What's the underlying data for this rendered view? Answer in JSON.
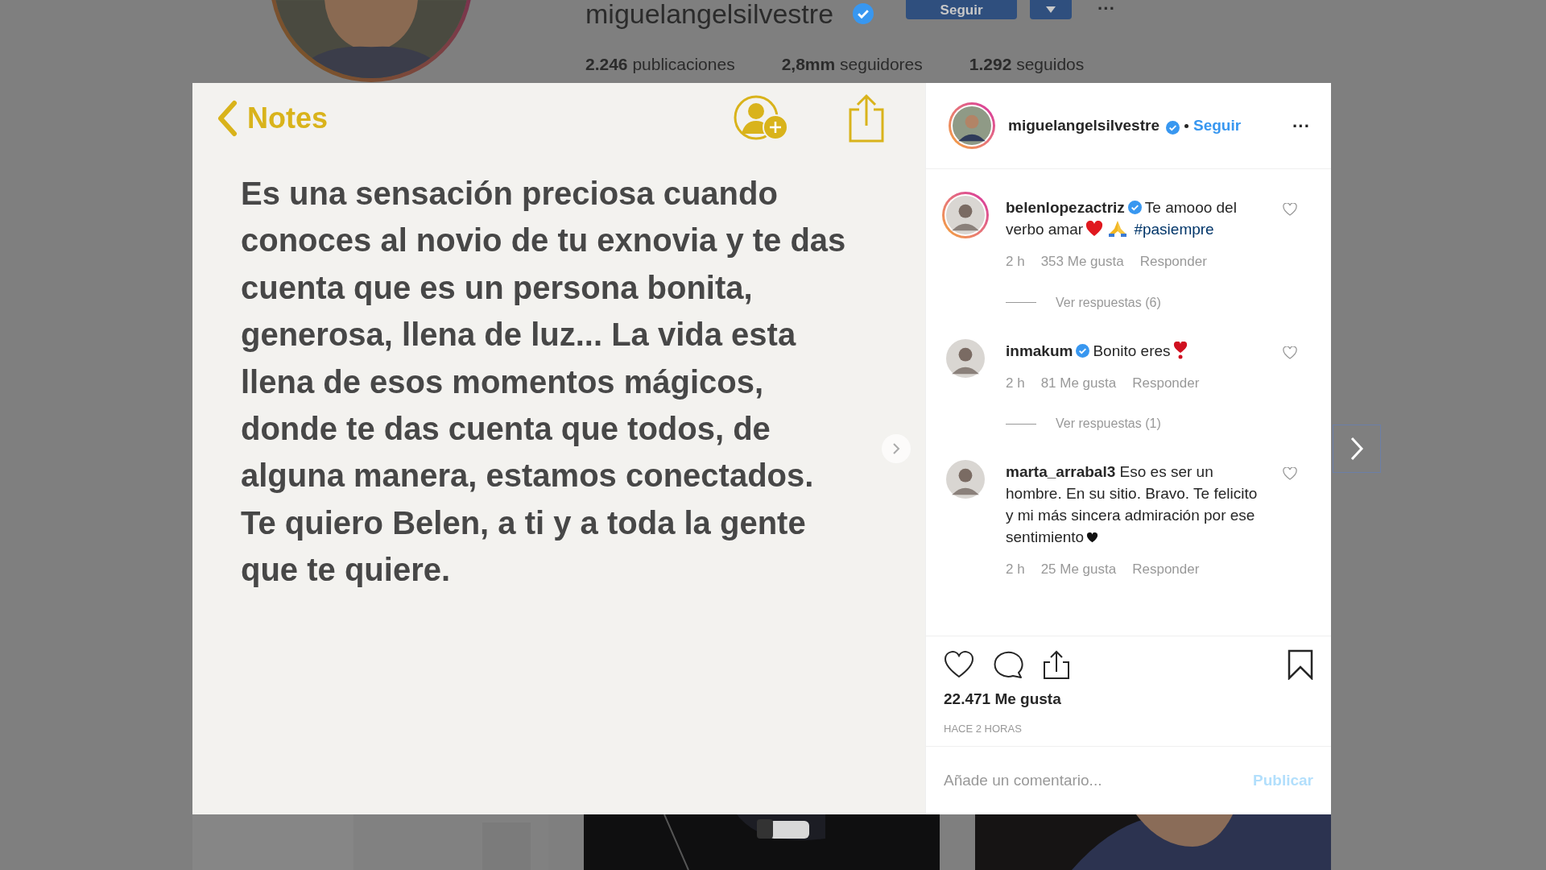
{
  "profile_header": {
    "username": "miguelangelsilvestre",
    "verified": true,
    "follow_button": "Seguir",
    "more": "···",
    "stats": [
      {
        "value": "2.246",
        "label": "publicaciones"
      },
      {
        "value": "2,8mm",
        "label": "seguidores"
      },
      {
        "value": "1.292",
        "label": "seguidos"
      }
    ]
  },
  "post_image": {
    "back_label": "Notes",
    "note_lines": [
      "Es una sensación preciosa cuando",
      "conoces al novio de tu exnovia y te das",
      "cuenta que es un persona bonita,",
      "generosa, llena de luz... La vida esta",
      "llena de esos momentos mágicos,",
      "donde te das cuenta que todos, de",
      "alguna manera, estamos conectados.",
      "Te quiero Belen, a ti y a toda la gente",
      "que te quiere."
    ]
  },
  "post_panel": {
    "author": {
      "username": "miguelangelsilvestre",
      "verified": true,
      "follow": "Seguir",
      "more": "···"
    },
    "comments": [
      {
        "username": "belenlopezactriz",
        "verified": true,
        "story_ring": true,
        "parts": [
          {
            "kind": "text",
            "text": "Te amooo del verbo amar"
          },
          {
            "kind": "red-heart"
          },
          {
            "kind": "praying-hands"
          },
          {
            "kind": "hashtag",
            "text": "#pasiempre"
          }
        ],
        "time": "2 h",
        "likes": "353 Me gusta",
        "reply": "Responder",
        "view_replies": "Ver respuestas (6)"
      },
      {
        "username": "inmakum",
        "verified": true,
        "story_ring": false,
        "parts": [
          {
            "kind": "text",
            "text": "Bonito eres"
          },
          {
            "kind": "heart-exclamation"
          }
        ],
        "time": "2 h",
        "likes": "81 Me gusta",
        "reply": "Responder",
        "view_replies": "Ver respuestas (1)"
      },
      {
        "username": "marta_arrabal3",
        "verified": false,
        "story_ring": false,
        "parts": [
          {
            "kind": "text",
            "text": "Eso es ser un hombre. En su sitio. Bravo. Te felicito y mi más sincera admiración por ese sentimiento"
          },
          {
            "kind": "black-heart"
          }
        ],
        "time": "2 h",
        "likes": "25 Me gusta",
        "reply": "Responder"
      }
    ],
    "likes": "22.471 Me gusta",
    "time": "HACE 2 HORAS",
    "comment_input": {
      "placeholder": "Añade un comentario..."
    },
    "publish_button": "Publicar"
  }
}
